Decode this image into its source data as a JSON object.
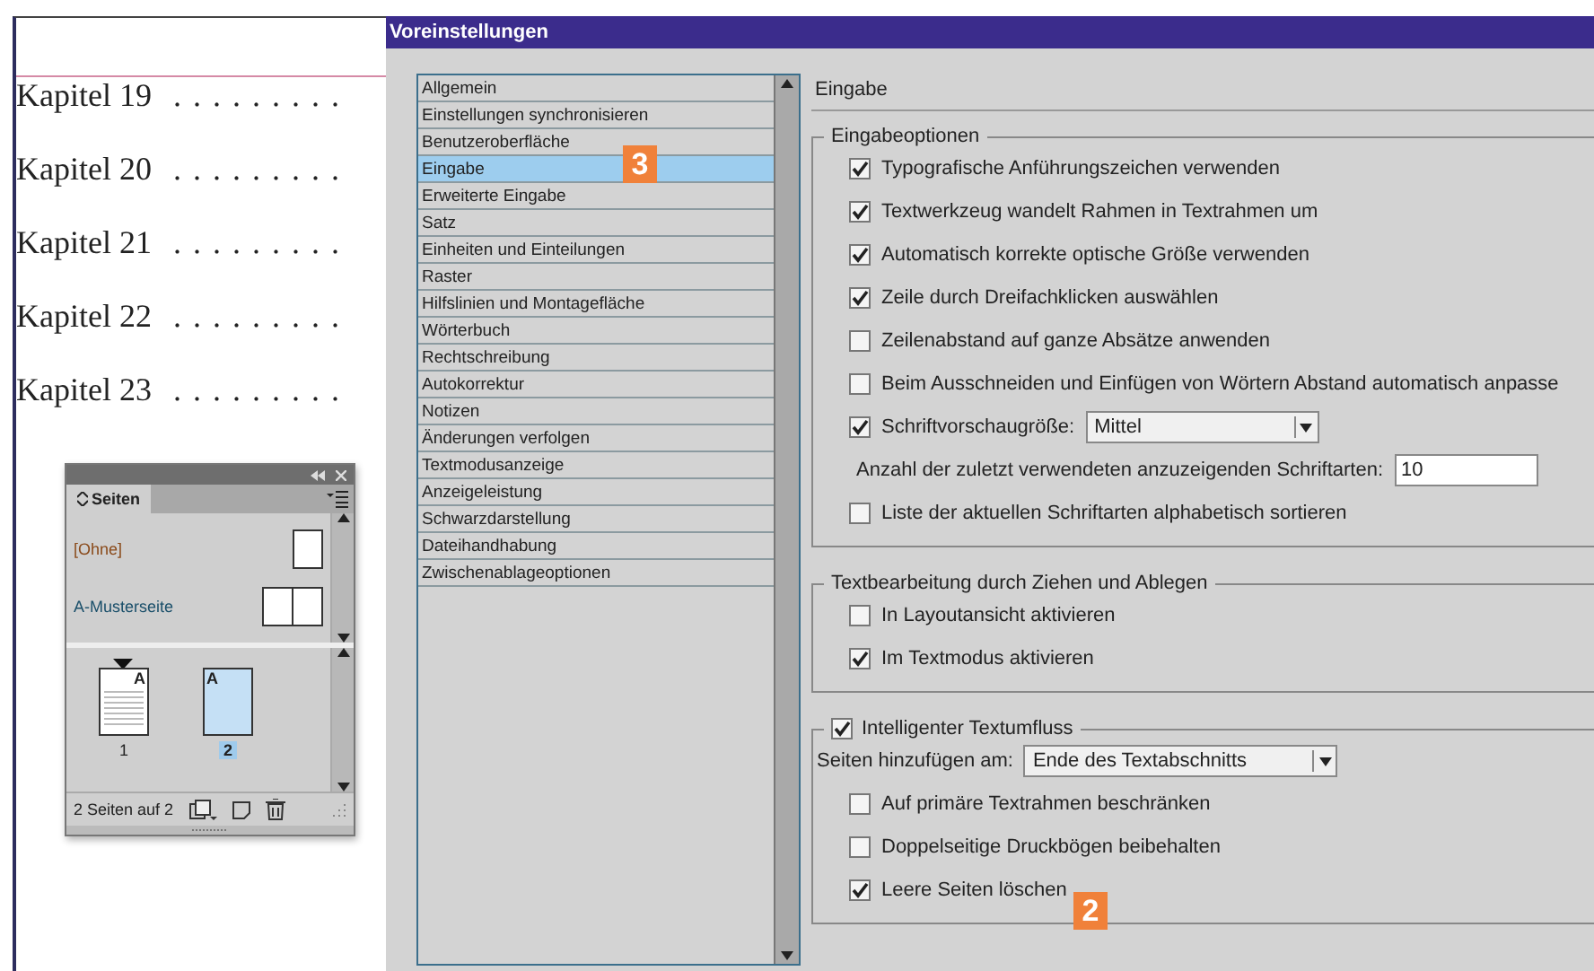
{
  "document": {
    "chapters": [
      {
        "title": "Kapitel 19",
        "leader": ". . . . . . . . ."
      },
      {
        "title": "Kapitel 20",
        "leader": ". . . . . . . . ."
      },
      {
        "title": "Kapitel 21",
        "leader": ". . . . . . . . ."
      },
      {
        "title": "Kapitel 22",
        "leader": ". . . . . . . . ."
      },
      {
        "title": "Kapitel 23",
        "leader": ". . . . . . . . ."
      }
    ]
  },
  "pages_panel": {
    "tab": "Seiten",
    "masters": [
      {
        "name": "[Ohne]",
        "kind": "single"
      },
      {
        "name": "A-Musterseite",
        "kind": "spread"
      }
    ],
    "pages": [
      {
        "number": "1",
        "master": "A",
        "selected": false,
        "current": true
      },
      {
        "number": "2",
        "master": "A",
        "selected": true,
        "current": false
      }
    ],
    "status": "2 Seiten auf 2"
  },
  "dialog": {
    "title": "Voreinstellungen",
    "categories": [
      {
        "label": "Allgemein",
        "selected": false
      },
      {
        "label": "Einstellungen synchronisieren",
        "selected": false
      },
      {
        "label": "Benutzeroberfläche",
        "selected": false
      },
      {
        "label": "Eingabe",
        "selected": true
      },
      {
        "label": "Erweiterte Eingabe",
        "selected": false
      },
      {
        "label": "Satz",
        "selected": false
      },
      {
        "label": "Einheiten und Einteilungen",
        "selected": false
      },
      {
        "label": "Raster",
        "selected": false
      },
      {
        "label": "Hilfslinien und Montagefläche",
        "selected": false
      },
      {
        "label": "Wörterbuch",
        "selected": false
      },
      {
        "label": "Rechtschreibung",
        "selected": false
      },
      {
        "label": "Autokorrektur",
        "selected": false
      },
      {
        "label": "Notizen",
        "selected": false
      },
      {
        "label": "Änderungen verfolgen",
        "selected": false
      },
      {
        "label": "Textmodusanzeige",
        "selected": false
      },
      {
        "label": "Anzeigeleistung",
        "selected": false
      },
      {
        "label": "Schwarzdarstellung",
        "selected": false
      },
      {
        "label": "Dateihandhabung",
        "selected": false
      },
      {
        "label": "Zwischenablageoptionen",
        "selected": false
      }
    ],
    "section_title": "Eingabe",
    "groups": [
      {
        "title": "Eingabeoptionen",
        "items": [
          {
            "kind": "checkbox",
            "label": "Typografische Anführungszeichen verwenden",
            "checked": true
          },
          {
            "kind": "checkbox",
            "label": "Textwerkzeug wandelt Rahmen in Textrahmen um",
            "checked": true
          },
          {
            "kind": "checkbox",
            "label": "Automatisch korrekte optische Größe verwenden",
            "checked": true
          },
          {
            "kind": "checkbox",
            "label": "Zeile durch Dreifachklicken auswählen",
            "checked": true
          },
          {
            "kind": "checkbox",
            "label": "Zeilenabstand auf ganze Absätze anwenden",
            "checked": false
          },
          {
            "kind": "checkbox",
            "label": "Beim Ausschneiden und Einfügen von Wörtern Abstand automatisch anpasse",
            "checked": false
          },
          {
            "kind": "checkselect",
            "label": "Schriftvorschaugröße:",
            "checked": true,
            "value": "Mittel"
          },
          {
            "kind": "number",
            "label": "Anzahl der zuletzt verwendeten anzuzeigenden Schriftarten:",
            "value": "10"
          },
          {
            "kind": "checkbox",
            "label": "Liste der aktuellen Schriftarten alphabetisch sortieren",
            "checked": false
          }
        ]
      },
      {
        "title": "Textbearbeitung durch Ziehen und Ablegen",
        "items": [
          {
            "kind": "checkbox",
            "label": "In Layoutansicht aktivieren",
            "checked": false
          },
          {
            "kind": "checkbox",
            "label": "Im Textmodus aktivieren",
            "checked": true
          }
        ]
      },
      {
        "title": "Intelligenter Textumfluss",
        "title_checked": true,
        "items": [
          {
            "kind": "select",
            "label": "Seiten hinzufügen am:",
            "value": "Ende des Textabschnitts"
          },
          {
            "kind": "checkbox",
            "label": "Auf primäre Textrahmen beschränken",
            "checked": false
          },
          {
            "kind": "checkbox",
            "label": "Doppelseitige Druckbögen beibehalten",
            "checked": false
          },
          {
            "kind": "checkbox",
            "label": "Leere Seiten löschen",
            "checked": true
          }
        ]
      }
    ]
  },
  "callouts": [
    {
      "text": "3"
    },
    {
      "text": "2"
    }
  ]
}
